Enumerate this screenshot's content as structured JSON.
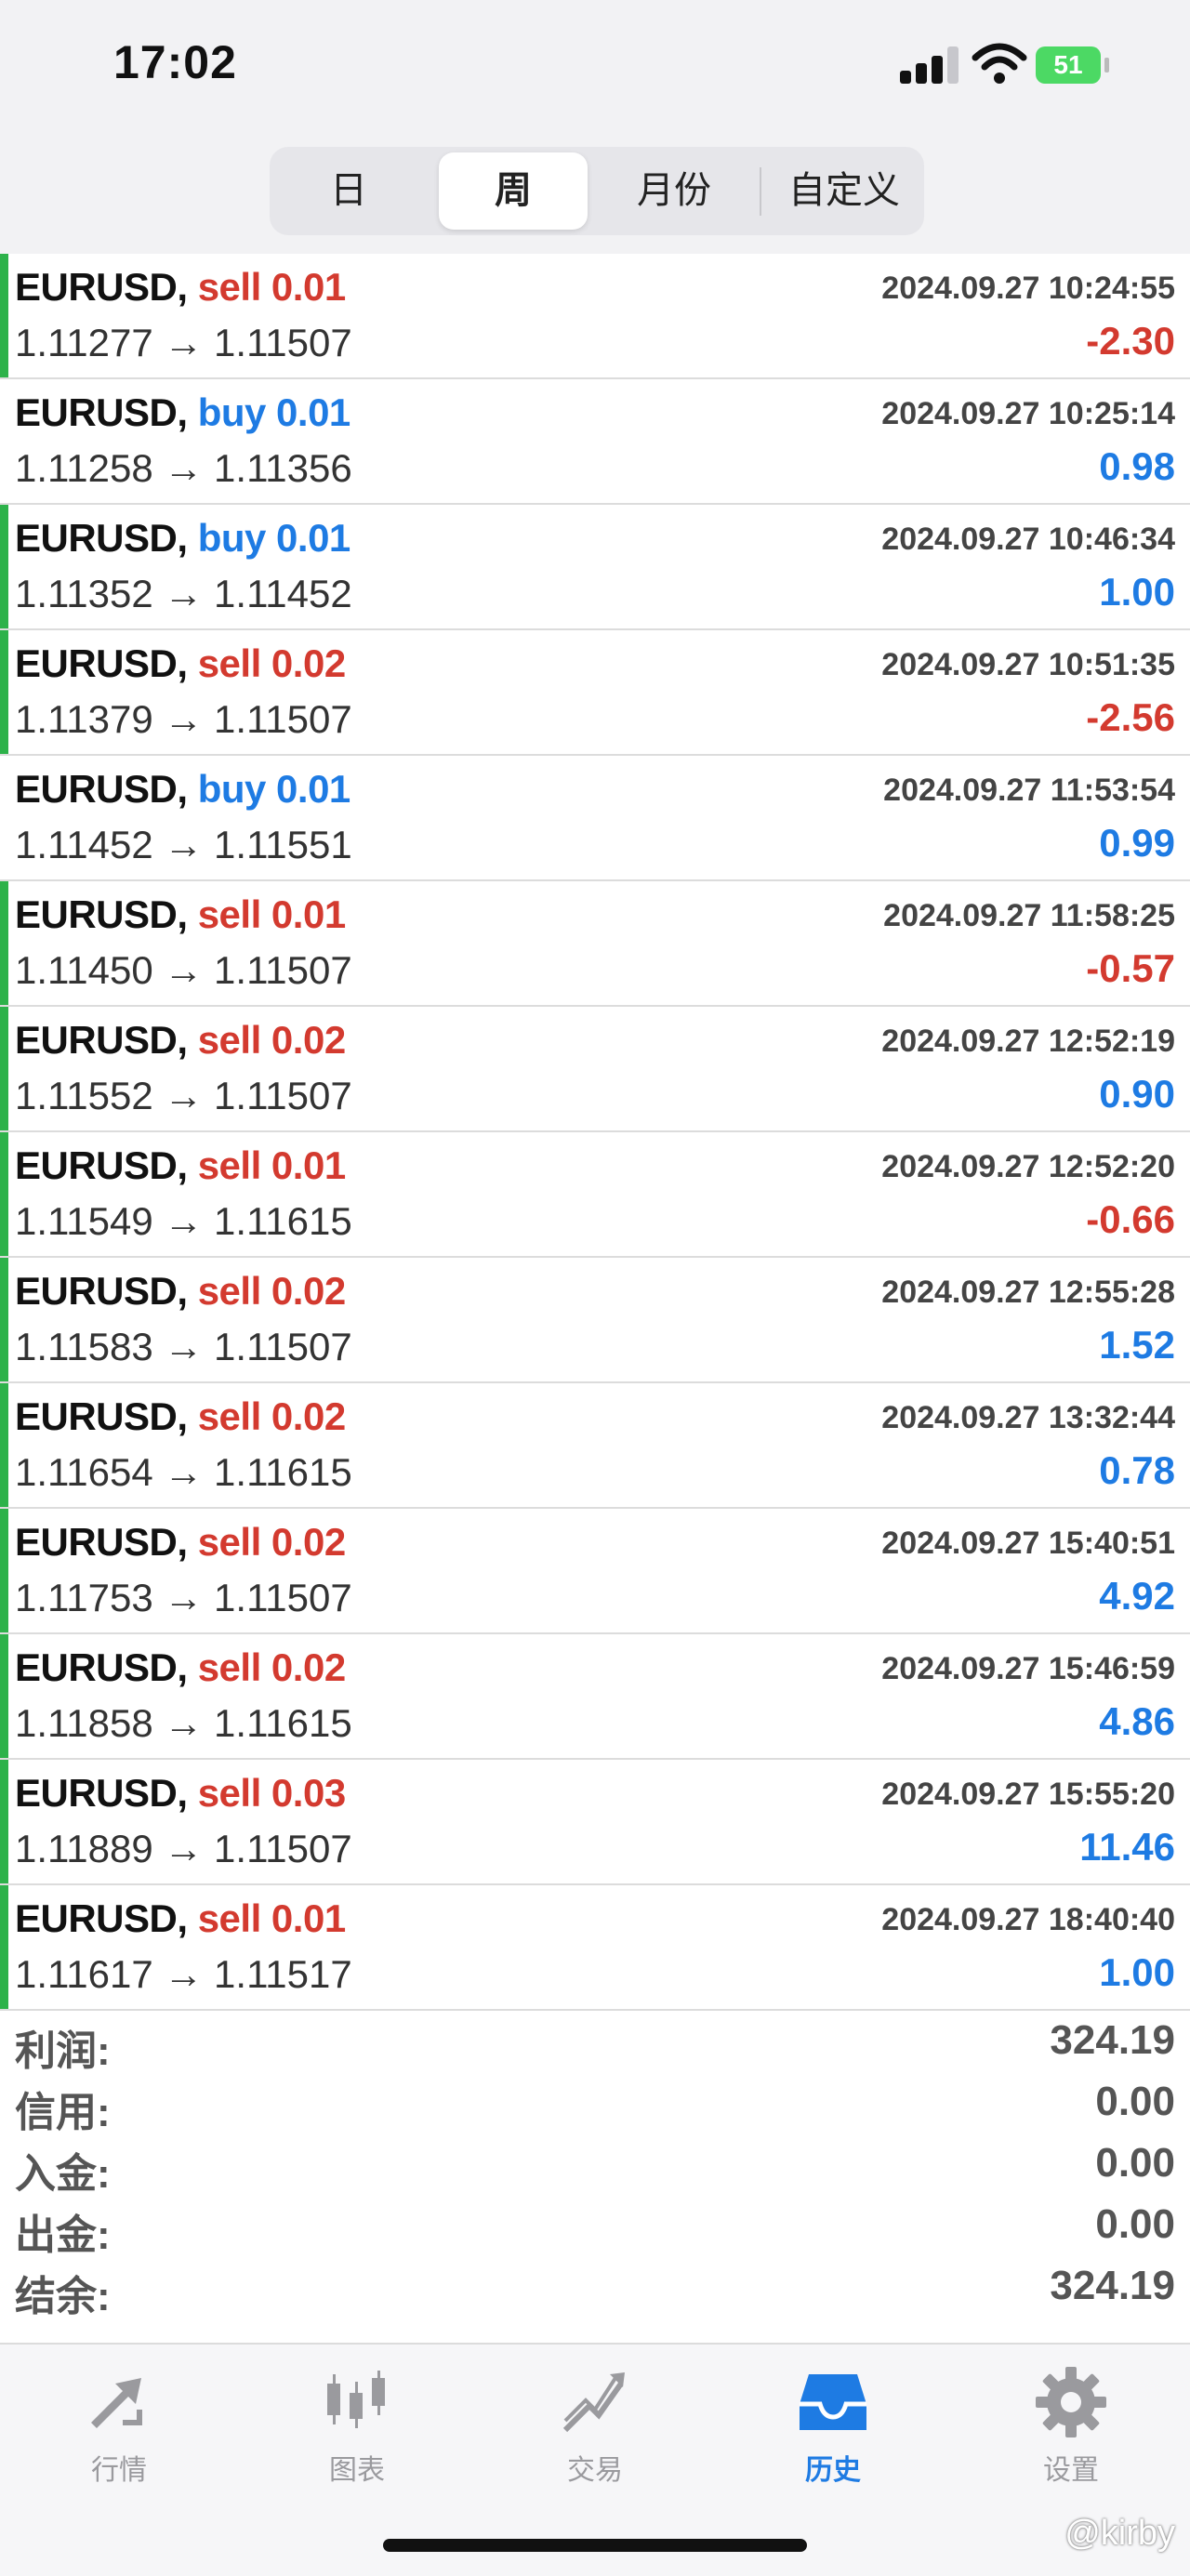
{
  "status_bar": {
    "time": "17:02",
    "battery": "51"
  },
  "segmented": {
    "day": "日",
    "week": "周",
    "month": "月份",
    "custom": "自定义",
    "active": "周"
  },
  "trades": [
    {
      "symbol": "EURUSD,",
      "side": "sell 0.01",
      "type": "sell",
      "prices": "1.11277 → 1.11507",
      "datetime": "2024.09.27 10:24:55",
      "profit": "-2.30",
      "sign": "neg",
      "marker": true
    },
    {
      "symbol": "EURUSD,",
      "side": "buy 0.01",
      "type": "buy",
      "prices": "1.11258 → 1.11356",
      "datetime": "2024.09.27 10:25:14",
      "profit": "0.98",
      "sign": "pos",
      "marker": false
    },
    {
      "symbol": "EURUSD,",
      "side": "buy 0.01",
      "type": "buy",
      "prices": "1.11352 → 1.11452",
      "datetime": "2024.09.27 10:46:34",
      "profit": "1.00",
      "sign": "pos",
      "marker": true
    },
    {
      "symbol": "EURUSD,",
      "side": "sell 0.02",
      "type": "sell",
      "prices": "1.11379 → 1.11507",
      "datetime": "2024.09.27 10:51:35",
      "profit": "-2.56",
      "sign": "neg",
      "marker": true
    },
    {
      "symbol": "EURUSD,",
      "side": "buy 0.01",
      "type": "buy",
      "prices": "1.11452 → 1.11551",
      "datetime": "2024.09.27 11:53:54",
      "profit": "0.99",
      "sign": "pos",
      "marker": false
    },
    {
      "symbol": "EURUSD,",
      "side": "sell 0.01",
      "type": "sell",
      "prices": "1.11450 → 1.11507",
      "datetime": "2024.09.27 11:58:25",
      "profit": "-0.57",
      "sign": "neg",
      "marker": true
    },
    {
      "symbol": "EURUSD,",
      "side": "sell 0.02",
      "type": "sell",
      "prices": "1.11552 → 1.11507",
      "datetime": "2024.09.27 12:52:19",
      "profit": "0.90",
      "sign": "pos",
      "marker": true
    },
    {
      "symbol": "EURUSD,",
      "side": "sell 0.01",
      "type": "sell",
      "prices": "1.11549 → 1.11615",
      "datetime": "2024.09.27 12:52:20",
      "profit": "-0.66",
      "sign": "neg",
      "marker": true
    },
    {
      "symbol": "EURUSD,",
      "side": "sell 0.02",
      "type": "sell",
      "prices": "1.11583 → 1.11507",
      "datetime": "2024.09.27 12:55:28",
      "profit": "1.52",
      "sign": "pos",
      "marker": true
    },
    {
      "symbol": "EURUSD,",
      "side": "sell 0.02",
      "type": "sell",
      "prices": "1.11654 → 1.11615",
      "datetime": "2024.09.27 13:32:44",
      "profit": "0.78",
      "sign": "pos",
      "marker": true
    },
    {
      "symbol": "EURUSD,",
      "side": "sell 0.02",
      "type": "sell",
      "prices": "1.11753 → 1.11507",
      "datetime": "2024.09.27 15:40:51",
      "profit": "4.92",
      "sign": "pos",
      "marker": true
    },
    {
      "symbol": "EURUSD,",
      "side": "sell 0.02",
      "type": "sell",
      "prices": "1.11858 → 1.11615",
      "datetime": "2024.09.27 15:46:59",
      "profit": "4.86",
      "sign": "pos",
      "marker": true
    },
    {
      "symbol": "EURUSD,",
      "side": "sell 0.03",
      "type": "sell",
      "prices": "1.11889 → 1.11507",
      "datetime": "2024.09.27 15:55:20",
      "profit": "11.46",
      "sign": "pos",
      "marker": true
    },
    {
      "symbol": "EURUSD,",
      "side": "sell 0.01",
      "type": "sell",
      "prices": "1.11617 → 1.11517",
      "datetime": "2024.09.27 18:40:40",
      "profit": "1.00",
      "sign": "pos",
      "marker": true
    }
  ],
  "summary": [
    {
      "label": "利润:",
      "value": "324.19"
    },
    {
      "label": "信用:",
      "value": "0.00"
    },
    {
      "label": "入金:",
      "value": "0.00"
    },
    {
      "label": "出金:",
      "value": "0.00"
    },
    {
      "label": "结余:",
      "value": "324.19"
    }
  ],
  "tabbar": {
    "quotes": "行情",
    "chart": "图表",
    "trade": "交易",
    "history": "历史",
    "settings": "设置",
    "active": "历史"
  },
  "watermark": "@kirby",
  "colors": {
    "sell": "#d33a2f",
    "buy": "#1e7be3",
    "marker": "#2db24a",
    "active_tab": "#1e7be3"
  }
}
